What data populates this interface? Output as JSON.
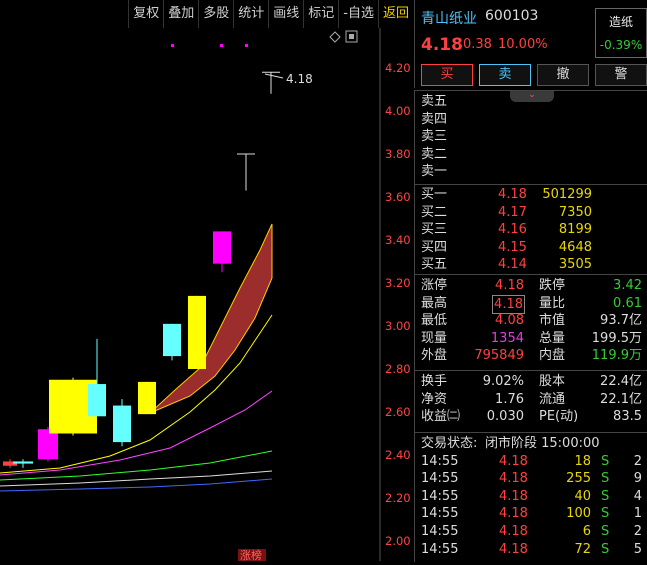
{
  "toolbar": {
    "items": [
      "复权",
      "叠加",
      "多股",
      "统计",
      "画线",
      "标记",
      "-自选",
      "返回"
    ]
  },
  "chart": {
    "price_labels": [
      "4.20",
      "4.00",
      "3.80",
      "3.60",
      "3.40",
      "3.20",
      "3.00",
      "2.80",
      "2.60",
      "2.40",
      "2.20",
      "2.00"
    ],
    "high_marker": "4.18",
    "bottom_tag": "涨榜"
  },
  "chart_data": {
    "type": "candlestick",
    "ohlc": [
      {
        "open": 2.37,
        "close": 2.35,
        "high": 2.38,
        "low": 2.34
      },
      {
        "open": 2.36,
        "close": 2.37,
        "high": 2.38,
        "low": 2.34
      },
      {
        "open": 2.38,
        "close": 2.52,
        "high": 2.53,
        "low": 2.37
      },
      {
        "open": 2.75,
        "close": 2.5,
        "high": 2.76,
        "low": 2.49
      },
      {
        "open": 2.58,
        "close": 2.73,
        "high": 2.94,
        "low": 2.58
      },
      {
        "open": 2.46,
        "close": 2.63,
        "high": 2.66,
        "low": 2.44
      },
      {
        "open": 2.59,
        "close": 2.74,
        "high": 2.74,
        "low": 2.59
      },
      {
        "open": 2.86,
        "close": 3.01,
        "high": 3.01,
        "low": 2.84
      },
      {
        "open": 2.8,
        "close": 3.14,
        "high": 3.14,
        "low": 2.8
      },
      {
        "open": 3.44,
        "close": 3.29,
        "high": 3.44,
        "low": 3.25
      },
      {
        "open": 3.8,
        "close": 3.8,
        "high": 3.8,
        "low": 3.63
      },
      {
        "open": 4.18,
        "close": 4.18,
        "high": 4.18,
        "low": 4.08
      }
    ],
    "ylim": [
      1.98,
      4.28
    ]
  },
  "stock": {
    "name": "青山纸业",
    "code": "600103",
    "price": "4.18",
    "change": "0.38",
    "change_pct": "10.00%",
    "sector_name": "造纸",
    "sector_pct": "-0.39%"
  },
  "actions": [
    "买",
    "卖",
    "撤",
    "警"
  ],
  "expand_glyph": "⌄",
  "asks": [
    {
      "label": "卖五",
      "price": "",
      "vol": ""
    },
    {
      "label": "卖四",
      "price": "",
      "vol": ""
    },
    {
      "label": "卖三",
      "price": "",
      "vol": ""
    },
    {
      "label": "卖二",
      "price": "",
      "vol": ""
    },
    {
      "label": "卖一",
      "price": "",
      "vol": ""
    }
  ],
  "bids": [
    {
      "label": "买一",
      "price": "4.18",
      "vol": "501299"
    },
    {
      "label": "买二",
      "price": "4.17",
      "vol": "7350"
    },
    {
      "label": "买三",
      "price": "4.16",
      "vol": "8199"
    },
    {
      "label": "买四",
      "price": "4.15",
      "vol": "4648"
    },
    {
      "label": "买五",
      "price": "4.14",
      "vol": "3505"
    }
  ],
  "stats": [
    {
      "l1": "涨停",
      "v1": "4.18",
      "l2": "跌停",
      "v2": "3.42"
    },
    {
      "l1": "最高",
      "v1": "4.18",
      "l2": "量比",
      "v2": "0.61"
    },
    {
      "l1": "最低",
      "v1": "4.08",
      "l2": "市值",
      "v2": "93.7亿"
    },
    {
      "l1": "现量",
      "v1": "1354",
      "l2": "总量",
      "v2": "199.5万"
    },
    {
      "l1": "外盘",
      "v1": "795849",
      "l2": "内盘",
      "v2": "119.9万"
    }
  ],
  "stats2": [
    {
      "l1": "换手",
      "v1": "9.02%",
      "l2": "股本",
      "v2": "22.4亿"
    },
    {
      "l1": "净资",
      "v1": "1.76",
      "l2": "流通",
      "v2": "22.1亿"
    },
    {
      "l1": "收益㈡",
      "v1": "0.030",
      "l2": "PE(动)",
      "v2": "83.5"
    }
  ],
  "trade_status": {
    "label": "交易状态:",
    "value": "闭市阶段 15:00:00"
  },
  "ticks": [
    {
      "time": "14:55",
      "price": "4.18",
      "vol": "18",
      "side": "S",
      "num": "2"
    },
    {
      "time": "14:55",
      "price": "4.18",
      "vol": "255",
      "side": "S",
      "num": "9"
    },
    {
      "time": "14:55",
      "price": "4.18",
      "vol": "40",
      "side": "S",
      "num": "4"
    },
    {
      "time": "14:55",
      "price": "4.18",
      "vol": "100",
      "side": "S",
      "num": "1"
    },
    {
      "time": "14:55",
      "price": "4.18",
      "vol": "6",
      "side": "S",
      "num": "2"
    },
    {
      "time": "14:55",
      "price": "4.18",
      "vol": "72",
      "side": "S",
      "num": "5"
    }
  ],
  "colors": {
    "up": "#ff4040",
    "down": "#33cc33",
    "cyan": "#66ffff",
    "yellow": "#ffff00",
    "magenta": "#ff00ff"
  }
}
